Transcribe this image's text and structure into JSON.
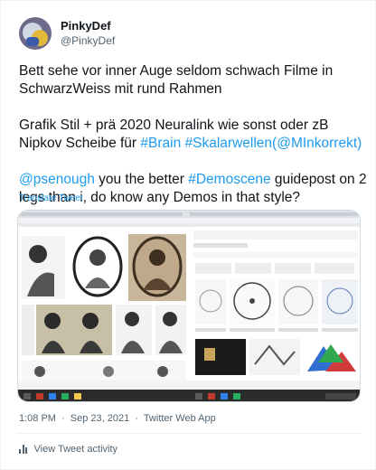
{
  "author": {
    "display_name": "PinkyDef",
    "handle": "@PinkyDef"
  },
  "tweet": {
    "paragraph1": "Bett sehe vor inner Auge seldom schwach Filme in SchwarzWeiss mit rund Rahmen",
    "paragraph2_prefix": "Grafik Stil + prä 2020 Neuralink wie sonst oder zB Nipkov Scheibe für ",
    "hashtag_brain": "#Brain",
    "hashtag_skalar": "#Skalarwellen",
    "mention_open": "(",
    "mention_mi": "@MInkorrekt",
    "mention_close": ")",
    "mention_psenough": "@psenough",
    "paragraph3_mid": " you the better ",
    "hashtag_demoscene": "#Demoscene",
    "paragraph3_suffix": " guidepost on 2 legs than i, do know any Demos in that style?"
  },
  "translate_label": "Translate Tweet",
  "meta": {
    "time": "1:08 PM",
    "separator1": "·",
    "date": "Sep 23, 2021",
    "separator2": "·",
    "source": "Twitter Web App"
  },
  "activity_label": "View Tweet activity",
  "colors": {
    "link": "#1d9bf0",
    "text": "#0f1419",
    "secondary": "#536471"
  }
}
